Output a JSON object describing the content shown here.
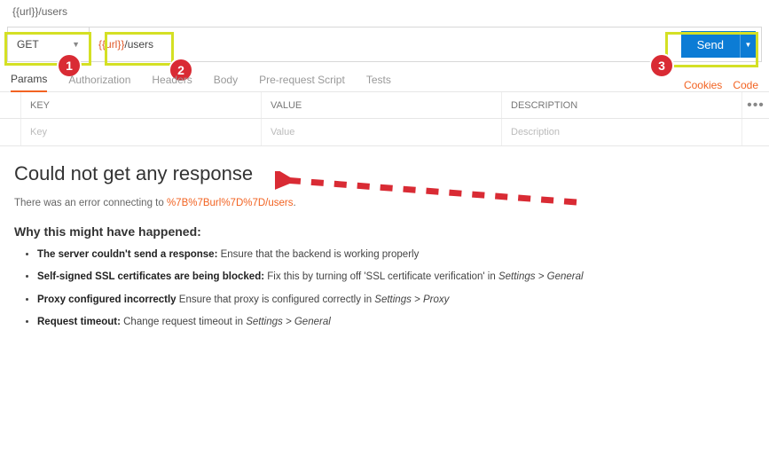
{
  "top": {
    "url_breadcrumb": "{{url}}/users"
  },
  "request": {
    "method": "GET",
    "url_variable": "{{url}}",
    "url_path": "/users",
    "send_label": "Send"
  },
  "tabs": {
    "items": [
      {
        "label": "Params",
        "active": true
      },
      {
        "label": "Authorization",
        "active": false
      },
      {
        "label": "Headers",
        "active": false
      },
      {
        "label": "Body",
        "active": false
      },
      {
        "label": "Pre-request Script",
        "active": false
      },
      {
        "label": "Tests",
        "active": false
      }
    ],
    "cookies_label": "Cookies",
    "code_label": "Code"
  },
  "params_table": {
    "columns": [
      "KEY",
      "VALUE",
      "DESCRIPTION"
    ],
    "placeholders": [
      "Key",
      "Value",
      "Description"
    ]
  },
  "response": {
    "title": "Could not get any response",
    "error_prefix": "There was an error connecting to ",
    "error_url": "%7B%7Burl%7D%7D/users",
    "error_suffix": ".",
    "why_heading": "Why this might have happened:",
    "reasons": [
      {
        "bold": "The server couldn't send a response:",
        "text": " Ensure that the backend is working properly"
      },
      {
        "bold": "Self-signed SSL certificates are being blocked:",
        "text": " Fix this by turning off 'SSL certificate verification' in ",
        "ital": "Settings > General"
      },
      {
        "bold": "Proxy configured incorrectly",
        "text": " Ensure that proxy is configured correctly in ",
        "ital": "Settings > Proxy"
      },
      {
        "bold": "Request timeout:",
        "text": " Change request timeout in ",
        "ital": "Settings > General"
      }
    ]
  },
  "badges": {
    "b1": "1",
    "b2": "2",
    "b3": "3"
  }
}
